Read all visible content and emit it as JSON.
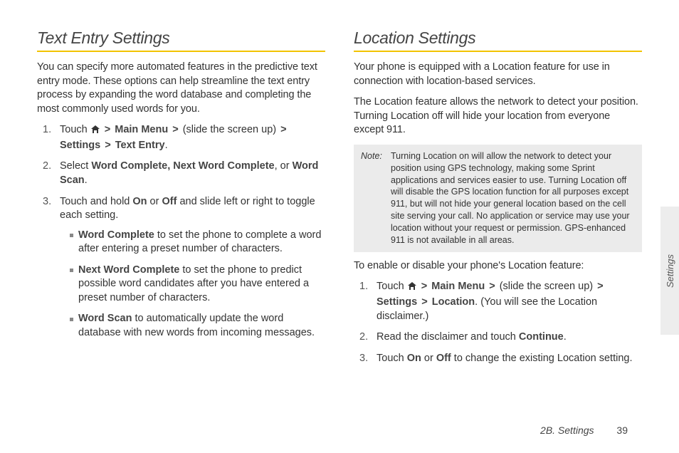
{
  "left": {
    "title": "Text Entry Settings",
    "intro": "You can specify more automated features in the predictive text entry mode. These options can help streamline the text entry process by expanding the word database and completing the most commonly used words for you.",
    "step1_touch": "Touch ",
    "step1_mainmenu": "Main Menu",
    "step1_slide": " (slide the screen up) ",
    "step1_settings": "Settings",
    "step1_textentry": "Text Entry",
    "step1_period": ".",
    "step2_select": "Select ",
    "step2_wc_nwc": "Word Complete, Next Word Complete",
    "step2_or": ", or ",
    "step2_ws": "Word Scan",
    "step2_period": ".",
    "step3a": "Touch and hold ",
    "step3_on": "On",
    "step3_or": " or ",
    "step3_off": "Off",
    "step3b": " and slide left or right to toggle each setting.",
    "b1_label": "Word Complete",
    "b1_text": " to set the phone to complete a word after entering a preset number of characters.",
    "b2_label": "Next Word Complete",
    "b2_text": " to set the phone to predict possible word candidates after you have entered a preset number of characters.",
    "b3_label": "Word Scan",
    "b3_text": " to automatically update the word database with new words from incoming messages."
  },
  "right": {
    "title": "Location Settings",
    "intro1": "Your phone is equipped with a Location feature for use in connection with location-based services.",
    "intro2": "The Location feature allows the network to detect your position. Turning Location off will hide your location from everyone except 911.",
    "note_label": "Note:",
    "note_text": "Turning Location on will allow the network to detect your position using GPS technology, making some Sprint applications and services easier to use. Turning Location off will disable the GPS location function for all purposes except 911, but will not hide your general location based on the cell site serving your call. No application or service may use your location without your request or permission. GPS-enhanced 911 is not available in all areas.",
    "enable": "To enable or disable your phone's Location feature:",
    "step1_touch": "Touch ",
    "step1_mainmenu": "Main Menu",
    "step1_slide": " (slide the screen up) ",
    "step1_settings": "Settings",
    "step1_location": "Location",
    "step1_tail": ". (You will see the Location disclaimer.)",
    "step2a": "Read the disclaimer and touch ",
    "step2_continue": "Continue",
    "step2b": ".",
    "step3a": "Touch ",
    "step3_on": "On",
    "step3_or": " or ",
    "step3_off": "Off",
    "step3b": " to change the existing Location setting."
  },
  "sidetab": "Settings",
  "footer_section": "2B. Settings",
  "footer_page": "39",
  "gt": ">"
}
